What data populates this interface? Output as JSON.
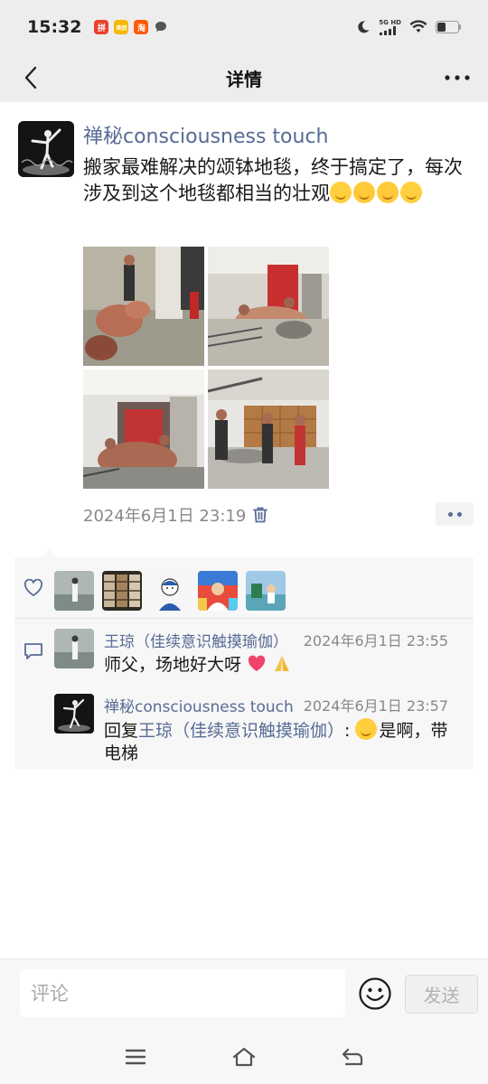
{
  "status_bar": {
    "time": "15:32",
    "network": "5G HD",
    "app_badges": [
      {
        "name": "pdd-app-icon",
        "glyph": "拼",
        "color": "#e8412c"
      },
      {
        "name": "meituan-app-icon",
        "glyph": "美团",
        "color": "#f6b800"
      },
      {
        "name": "taobao-app-icon",
        "glyph": "淘",
        "color": "#ff5a00"
      }
    ]
  },
  "nav": {
    "title": "详情"
  },
  "post": {
    "author": "禅秘consciousness touch",
    "text": "搬家最难解决的颂钵地毯，终于搞定了，每次涉及到这个地毯都相当的壮观",
    "timestamp": "2024年6月1日 23:19",
    "photo_count": 4
  },
  "likes": {
    "count": 5
  },
  "comments": [
    {
      "author": "王琼（佳续意识触摸瑜伽）",
      "time": "2024年6月1日 23:55",
      "text": "师父，场地好大呀"
    },
    {
      "author": "禅秘consciousness touch",
      "time": "2024年6月1日 23:57",
      "reply_prefix": "回复",
      "reply_to": "王琼（佳续意识触摸瑜伽）",
      "text": "是啊，带电梯"
    }
  ],
  "comment_bar": {
    "placeholder": "评论",
    "send_label": "发送"
  },
  "colors": {
    "link": "#576b95",
    "bar_bg": "#ededed"
  }
}
